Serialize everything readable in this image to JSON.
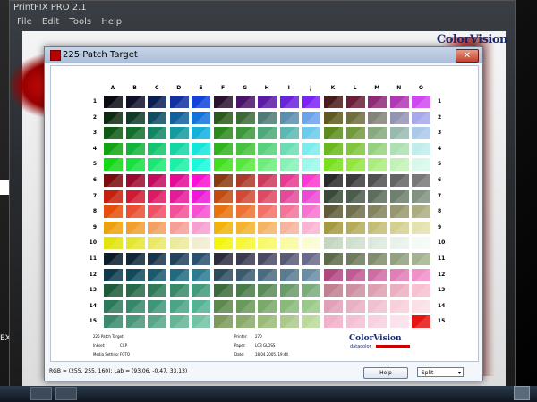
{
  "parent": {
    "title": "PrintFIX PRO 2.1",
    "menu": [
      "File",
      "Edit",
      "Tools",
      "Help"
    ],
    "brand": "ColorVision",
    "side_text": "EX"
  },
  "dialog": {
    "title": "225 Patch Target",
    "close_glyph": "✕"
  },
  "grid": {
    "columns": [
      "A",
      "B",
      "C",
      "D",
      "E",
      "F",
      "G",
      "H",
      "I",
      "J",
      "K",
      "L",
      "M",
      "N",
      "O"
    ],
    "rows": [
      "1",
      "2",
      "3",
      "4",
      "5",
      "6",
      "7",
      "8",
      "9",
      "10",
      "11",
      "12",
      "13",
      "14",
      "15"
    ],
    "colors": [
      [
        "#0b0b14",
        "#10102a",
        "#0c1f52",
        "#1230a1",
        "#1242d8",
        "#2a1230",
        "#4a1468",
        "#5c1aa5",
        "#6b22dc",
        "#7a24f4",
        "#4a1b1b",
        "#6a1e3a",
        "#8e2a78",
        "#b038b4",
        "#d048f2"
      ],
      [
        "#0d2a10",
        "#103a2a",
        "#104c62",
        "#12609e",
        "#1272dc",
        "#2a5a1c",
        "#3e6a3a",
        "#4f7c76",
        "#5c8eb0",
        "#6ca2ea",
        "#5c5a1e",
        "#6f6e3c",
        "#83837a",
        "#9494b2",
        "#a7a8ea"
      ],
      [
        "#0e5a14",
        "#12702c",
        "#128664",
        "#149aa0",
        "#14b0dc",
        "#2a8a1c",
        "#3c983a",
        "#4ea87a",
        "#5cb8b2",
        "#6ccaea",
        "#5c8c1e",
        "#729a3c",
        "#86aa7c",
        "#98baae",
        "#aacaea"
      ],
      [
        "#10a414",
        "#12b43c",
        "#14c46e",
        "#16d4a4",
        "#18e4d8",
        "#30b41e",
        "#46c23e",
        "#58d07c",
        "#6adeb2",
        "#7cecea",
        "#6ab81e",
        "#82c63e",
        "#96d27e",
        "#aee0b4",
        "#c2ecec"
      ],
      [
        "#12d816",
        "#18e040",
        "#1ae872",
        "#1af0a6",
        "#1af8dc",
        "#40e01c",
        "#58e63e",
        "#6eec7e",
        "#86f2b6",
        "#9cf8ea",
        "#78e01c",
        "#92e63e",
        "#aaec7e",
        "#c2f2b6",
        "#d8f8ea"
      ],
      [
        "#7a0c0c",
        "#9a0c2e",
        "#c40c5e",
        "#e40c96",
        "#fc10d0",
        "#8a3a10",
        "#ab3a2a",
        "#cc3a5c",
        "#e83a94",
        "#fc3ad0",
        "#2a2a2a",
        "#3c3c3c",
        "#505050",
        "#646464",
        "#787878"
      ],
      [
        "#c4200c",
        "#d01a32",
        "#dc1a62",
        "#e41a9a",
        "#ec1ad4",
        "#c44a10",
        "#d04a36",
        "#dc4a64",
        "#e44a9c",
        "#ec4ad4",
        "#3a4a3a",
        "#4a5c4a",
        "#5c6e5c",
        "#6e806e",
        "#809280"
      ],
      [
        "#e4500c",
        "#ea5030",
        "#ee5064",
        "#f25098",
        "#f650d0",
        "#e8720c",
        "#ec7232",
        "#f07266",
        "#f4729c",
        "#f872d2",
        "#5e5c3a",
        "#70704c",
        "#84845e",
        "#989870",
        "#acac82"
      ],
      [
        "#eea00c",
        "#f0a030",
        "#f2a064",
        "#f4a098",
        "#f6a0d0",
        "#f0b40c",
        "#f2b432",
        "#f4b466",
        "#f6b49c",
        "#f8b4d2",
        "#a49a40",
        "#b4ac5a",
        "#c4be76",
        "#d4d092",
        "#e4e2ae"
      ],
      [
        "#e2e40c",
        "#e6e632",
        "#eae866",
        "#eeea9c",
        "#f2ecd2",
        "#f4f40c",
        "#f6f634",
        "#f8f868",
        "#fafa9e",
        "#fcfcd4",
        "#c4d6c0",
        "#d0e0ce",
        "#dceadc",
        "#e8f2ea",
        "#f4faf6"
      ],
      [
        "#0c1c2a",
        "#12283a",
        "#1a344c",
        "#22425e",
        "#2a5070",
        "#2c2c3c",
        "#3a3a50",
        "#4a4a64",
        "#5a5a78",
        "#6a6a8c",
        "#5c6a4a",
        "#6e7c5c",
        "#808e6e",
        "#92a080",
        "#a4b292"
      ],
      [
        "#0c3a4c",
        "#124a5c",
        "#1a5a6e",
        "#226a80",
        "#2a7a92",
        "#2c4c5c",
        "#3a5c6e",
        "#4a6c80",
        "#5a7c92",
        "#6a8ca4",
        "#b04880",
        "#c05a92",
        "#d06ca4",
        "#e07eb6",
        "#f090c8"
      ],
      [
        "#1c5a3a",
        "#266a4a",
        "#307a5a",
        "#3a8a6a",
        "#449a7a",
        "#3c6c3c",
        "#4a7c4a",
        "#5a8c5a",
        "#6a9c6a",
        "#7aac7a",
        "#c08090",
        "#ce90a0",
        "#dca0b0",
        "#eab0c0",
        "#f8c0d0"
      ],
      [
        "#2c7a5c",
        "#36886a",
        "#409678",
        "#4aa486",
        "#54b294",
        "#5c8a4c",
        "#6a9a5a",
        "#7aaa6a",
        "#8aba7a",
        "#9aca8a",
        "#e0a0b8",
        "#e8b0c4",
        "#f0c0d0",
        "#f8d0dc",
        "#fce0e8"
      ],
      [
        "#3c8a6c",
        "#4a987a",
        "#58a688",
        "#66b496",
        "#74c2a4",
        "#7c9a5c",
        "#8aaa6a",
        "#9aba7a",
        "#aaca8a",
        "#bada9a",
        "#f0b0c8",
        "#f4c0d4",
        "#f8d0e0",
        "#fce0ec",
        "#e81414"
      ]
    ]
  },
  "info": {
    "left": [
      {
        "label": "225 Patch Target",
        "value": ""
      },
      {
        "label": "Inkset:",
        "value": "CCP"
      },
      {
        "label": "Media Setting:",
        "value": "FOTO"
      }
    ],
    "mid": [
      {
        "label": "Printer:",
        "value": "270"
      },
      {
        "label": "Paper:",
        "value": "LCB GLOSS"
      },
      {
        "label": "Date:",
        "value": "18.04.2005, 19:44"
      }
    ],
    "brand": "ColorVision",
    "brand_sub": "datacolor"
  },
  "status": {
    "readout": "RGB = (255, 255, 160); Lab = (93.06, -0.47, 33.13)",
    "help_label": "Help",
    "split_label": "Split"
  }
}
